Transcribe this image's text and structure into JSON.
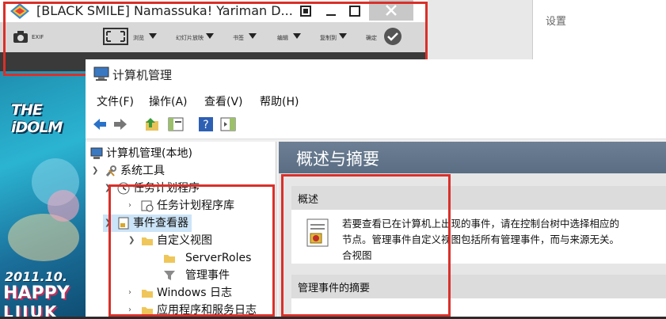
{
  "viewer": {
    "title": "[BLACK SMILE] Namassuka! Yariman D...",
    "toolbar": [
      {
        "label": "EXIF"
      },
      {
        "label": "浏览"
      },
      {
        "label": "幻灯片放映"
      },
      {
        "label": "书签"
      },
      {
        "label": "编辑"
      },
      {
        "label": "复制到"
      },
      {
        "label": "确定"
      }
    ]
  },
  "settings": {
    "title": "设置"
  },
  "background": {
    "logo": "THE iDOLM",
    "date": "2011.10.",
    "line1": "HAPPY",
    "line2": "LIJUK"
  },
  "cm": {
    "title": "计算机管理",
    "menu": [
      "文件(F)",
      "操作(A)",
      "查看(V)",
      "帮助(H)"
    ],
    "tree": [
      {
        "label": "计算机管理(本地)"
      },
      {
        "label": "系统工具"
      },
      {
        "label": "任务计划程序"
      },
      {
        "label": "任务计划程序库"
      },
      {
        "label": "事件查看器"
      },
      {
        "label": "自定义视图"
      },
      {
        "label": "ServerRoles"
      },
      {
        "label": "管理事件"
      },
      {
        "label": "Windows 日志"
      },
      {
        "label": "应用程序和服务日志"
      }
    ],
    "overview_title": "概述与摘要",
    "section1": "概述",
    "section1_text": [
      "若要查看已在计算机上出现的事件，请在控制台树中选择相应的",
      "节点。管理事件自定义视图包括所有管理事件，而与来源无关。",
      "合视图"
    ],
    "section2": "管理事件的摘要"
  },
  "colors": {
    "highlight_border": "#d9302a",
    "overview_header": "#5a6d83",
    "accent_blue": "#2a72c8"
  }
}
